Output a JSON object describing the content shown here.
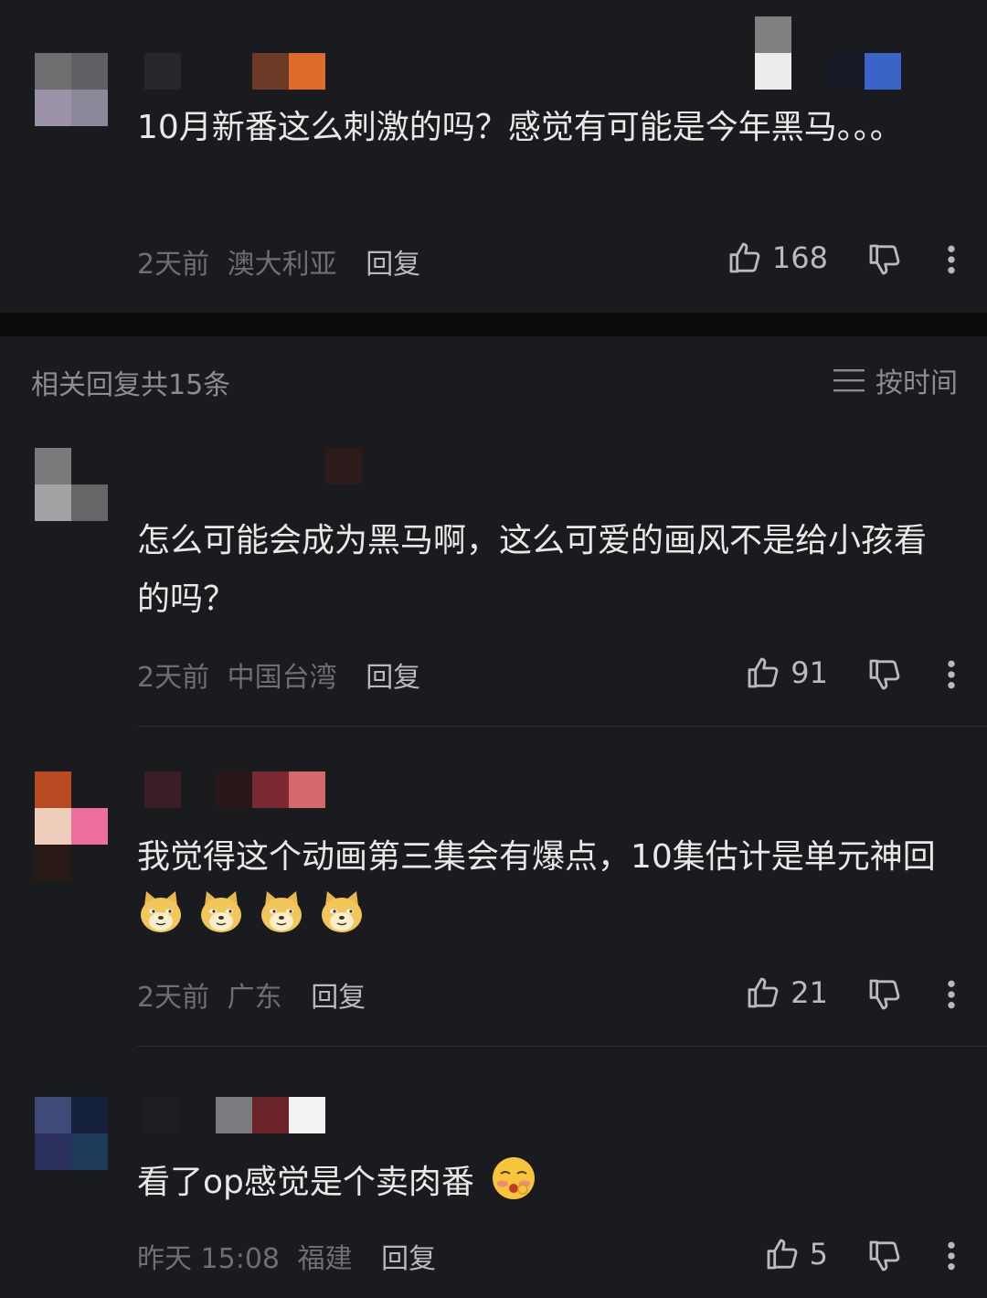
{
  "main_comment": {
    "text": "10月新番这么刺激的吗？感觉有可能是今年黑马。。。",
    "time": "2天前",
    "location": "澳大利亚",
    "reply_label": "回复",
    "likes": "168"
  },
  "replies_header": {
    "count_text": "相关回复共15条",
    "sort_label": "按时间"
  },
  "replies": [
    {
      "text": "怎么可能会成为黑马啊，这么可爱的画风不是给小孩看的吗？",
      "time": "2天前",
      "location": "中国台湾",
      "reply_label": "回复",
      "likes": "91"
    },
    {
      "text": "我觉得这个动画第三集会有爆点，10集估计是单元神回",
      "emojis": [
        "doge-emoji",
        "doge-emoji",
        "doge-emoji",
        "doge-emoji"
      ],
      "time": "2天前",
      "location": "广东",
      "reply_label": "回复",
      "likes": "21"
    },
    {
      "text": "看了op感觉是个卖肉番",
      "emojis": [
        "blushing-emoji"
      ],
      "time": "昨天 15:08",
      "location": "福建",
      "reply_label": "回复",
      "likes": "5"
    }
  ],
  "icons": {
    "like": "thumbs-up-icon",
    "dislike": "thumbs-down-icon",
    "more": "more-vertical-icon",
    "sort": "menu-lines-icon"
  },
  "colors": {
    "background": "#1a1b1e",
    "text": "#e8e8e8",
    "meta": "#6e6f73",
    "divider": "#0c0c0d"
  }
}
